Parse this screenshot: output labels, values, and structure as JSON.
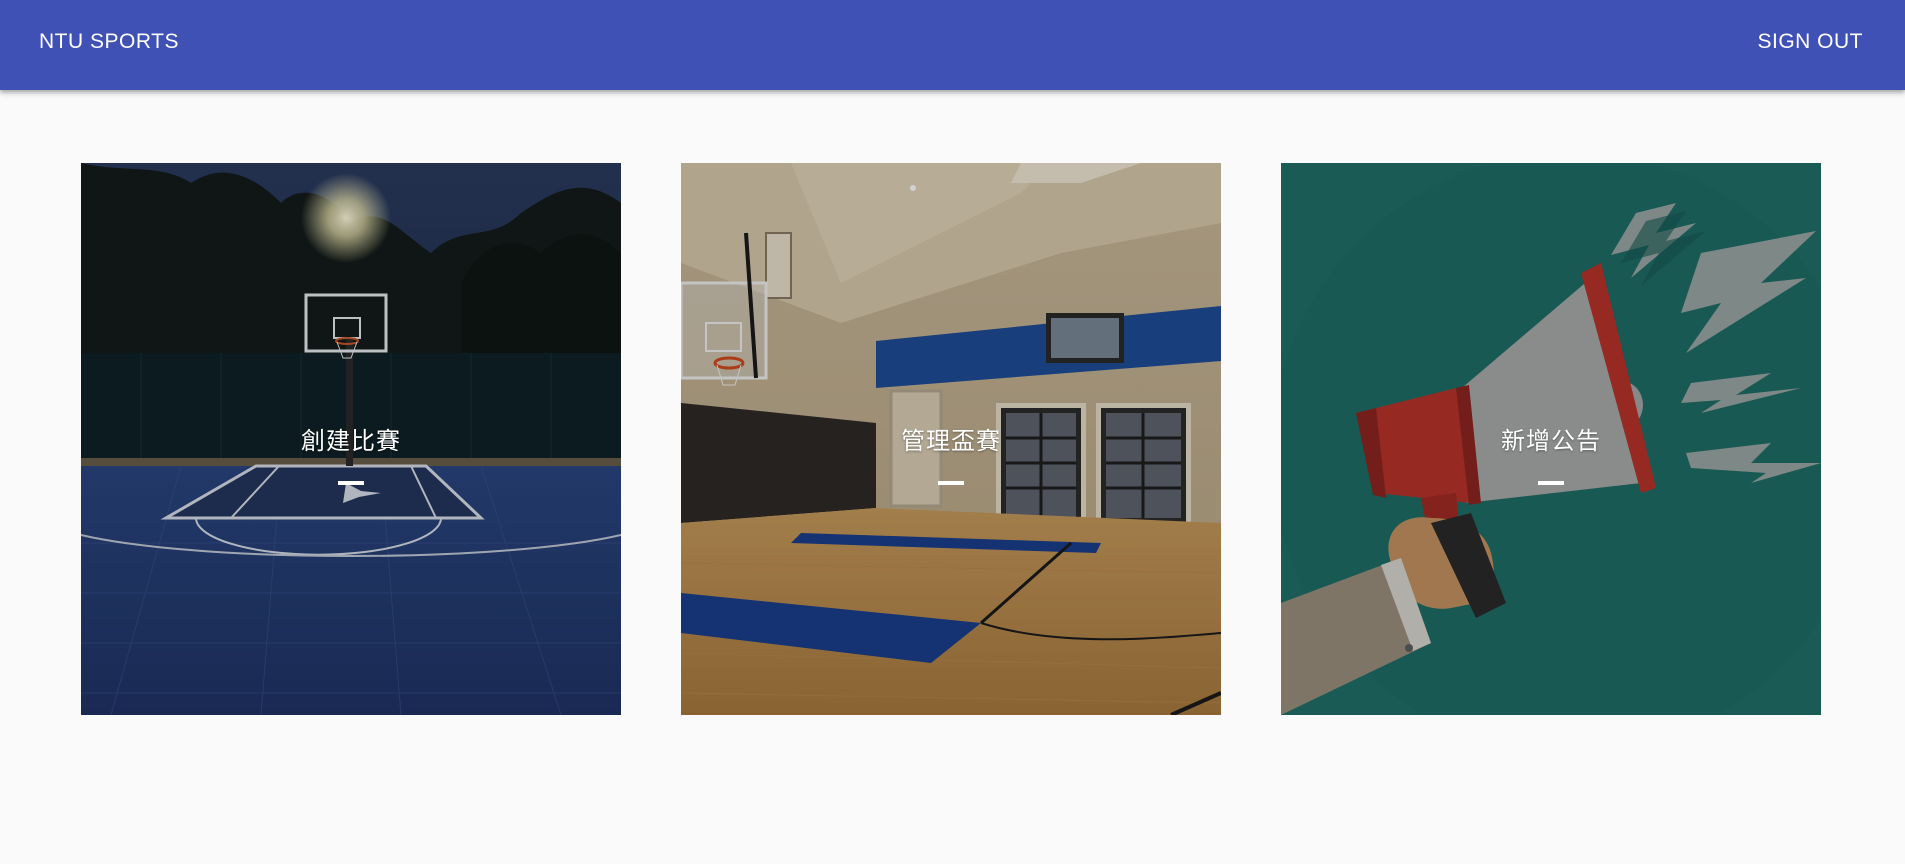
{
  "appbar": {
    "brand": "NTU SPORTS",
    "signout_label": "SIGN OUT",
    "color": "#3f51b5"
  },
  "tiles": [
    {
      "label": "創建比賽",
      "image": "outdoor-basketball-court-image"
    },
    {
      "label": "管理盃賽",
      "image": "indoor-basketball-gym-image"
    },
    {
      "label": "新增公告",
      "image": "megaphone-illustration"
    }
  ],
  "colors": {
    "background": "#fafafa",
    "announce_tile": "#20706a"
  }
}
